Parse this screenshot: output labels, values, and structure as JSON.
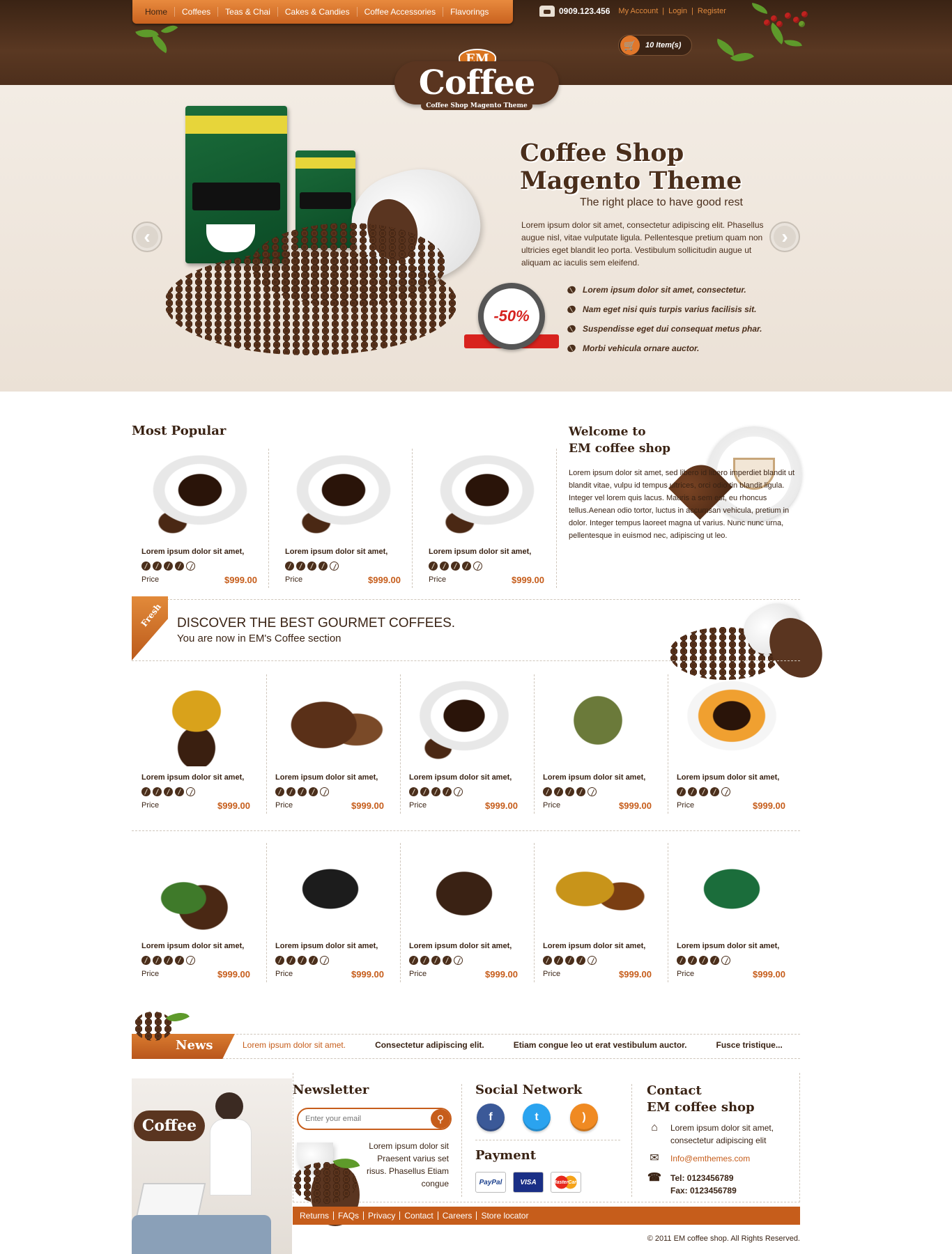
{
  "nav": {
    "items": [
      "Home",
      "Coffees",
      "Teas & Chai",
      "Cakes & Candies",
      "Coffee Accessories",
      "Flavorings"
    ]
  },
  "header": {
    "phone": "0909.123.456",
    "links": [
      "My Account",
      "Login",
      "Register"
    ],
    "cart_label": "10 Item(s)"
  },
  "logo": {
    "em": "EM",
    "name": "Coffee",
    "tagline": "Coffee Shop Magento Theme"
  },
  "hero": {
    "title_line1": "Coffee Shop",
    "title_line2": "Magento Theme",
    "tagline": "The right place to have good rest",
    "description": "Lorem ipsum dolor sit amet, consectetur adipiscing elit. Phasellus augue nisl, vitae vulputate ligula. Pellentesque pretium quam non ultricies eget blandit leo porta. Vestibulum sollicitudin augue ut aliquam ac iaculis sem eleifend.",
    "bullets": [
      "Lorem ipsum dolor sit amet, consectetur.",
      "Nam eget nisi quis turpis varius facilisis sit.",
      "Suspendisse eget dui consequat metus phar.",
      "Morbi vehicula ornare auctor."
    ],
    "discount": "-50%",
    "prev_arrow": "‹",
    "next_arrow": "›"
  },
  "most_popular": {
    "heading": "Most Popular",
    "products": [
      {
        "name": "Lorem ipsum dolor sit amet,",
        "rating": 4,
        "price_label": "Price",
        "price": "$999.00"
      },
      {
        "name": "Lorem ipsum dolor sit amet,",
        "rating": 4,
        "price_label": "Price",
        "price": "$999.00"
      },
      {
        "name": "Lorem ipsum dolor sit amet,",
        "rating": 4,
        "price_label": "Price",
        "price": "$999.00"
      }
    ]
  },
  "welcome": {
    "title_line1": "Welcome to",
    "title_line2": "EM coffee shop",
    "text": "Lorem ipsum dolor sit amet, sed libero id libero imperdiet blandit ut blandit vitae, vulpu id tempus ultrices, orci odio tin blandit ligula. Integer vel lorem quis lacus. Mauris a sem est, eu rhoncus tellus.Aenean odio tortor, luctus in accumsan vehicula, pretium in dolor. Integer tempus laoreet magna ut varius. Nunc nunc urna, pellentesque in euismod nec, adipiscing ut leo."
  },
  "discover": {
    "tab_label": "Fresh",
    "title": "DISCOVER THE BEST GOURMET COFFEES.",
    "subtitle": "You are now in EM's Coffee section",
    "row1": [
      {
        "name": "Lorem ipsum dolor sit amet,",
        "rating": 4,
        "price_label": "Price",
        "price": "$999.00"
      },
      {
        "name": "Lorem ipsum dolor sit amet,",
        "rating": 4,
        "price_label": "Price",
        "price": "$999.00"
      },
      {
        "name": "Lorem ipsum dolor sit amet,",
        "rating": 4,
        "price_label": "Price",
        "price": "$999.00"
      },
      {
        "name": "Lorem ipsum dolor sit amet,",
        "rating": 4,
        "price_label": "Price",
        "price": "$999.00"
      },
      {
        "name": "Lorem ipsum dolor sit amet,",
        "rating": 4,
        "price_label": "Price",
        "price": "$999.00"
      }
    ],
    "row2": [
      {
        "name": "Lorem ipsum dolor sit amet,",
        "rating": 4,
        "price_label": "Price",
        "price": "$999.00"
      },
      {
        "name": "Lorem ipsum dolor sit amet,",
        "rating": 4,
        "price_label": "Price",
        "price": "$999.00"
      },
      {
        "name": "Lorem ipsum dolor sit amet,",
        "rating": 4,
        "price_label": "Price",
        "price": "$999.00"
      },
      {
        "name": "Lorem ipsum dolor sit amet,",
        "rating": 4,
        "price_label": "Price",
        "price": "$999.00"
      },
      {
        "name": "Lorem ipsum dolor sit amet,",
        "rating": 4,
        "price_label": "Price",
        "price": "$999.00"
      }
    ]
  },
  "news": {
    "label": "News",
    "items": [
      "Lorem ipsum dolor sit amet.",
      "Consectetur adipiscing elit.",
      "Etiam congue leo ut erat vestibulum auctor.",
      "Fusce tristique..."
    ]
  },
  "footer": {
    "logo_text": "Coffee",
    "newsletter": {
      "heading": "Newsletter",
      "placeholder": "Enter your email",
      "text": "Lorem ipsum dolor sit Praesent varius set risus. Phasellus Etiam congue"
    },
    "social": {
      "heading": "Social Network",
      "icons": [
        "facebook-icon",
        "twitter-icon",
        "rss-icon"
      ]
    },
    "payment": {
      "heading": "Payment",
      "methods": [
        "PayPal",
        "VISA",
        "MasterCard"
      ]
    },
    "contact": {
      "heading_line1": "Contact",
      "heading_line2": "EM coffee shop",
      "address": "Lorem ipsum dolor sit amet, consectetur adipiscing elit",
      "email": "Info@emthemes.com",
      "tel": "Tel: 0123456789",
      "fax": "Fax: 0123456789"
    },
    "links": [
      "Returns",
      "FAQs",
      "Privacy",
      "Contact",
      "Careers",
      "Store locator"
    ],
    "copyright": "© 2011 EM coffee shop. All Rights Reserved."
  },
  "colors": {
    "brown": "#3a2314",
    "orange": "#c65d1b",
    "cream": "#f3ece4"
  }
}
